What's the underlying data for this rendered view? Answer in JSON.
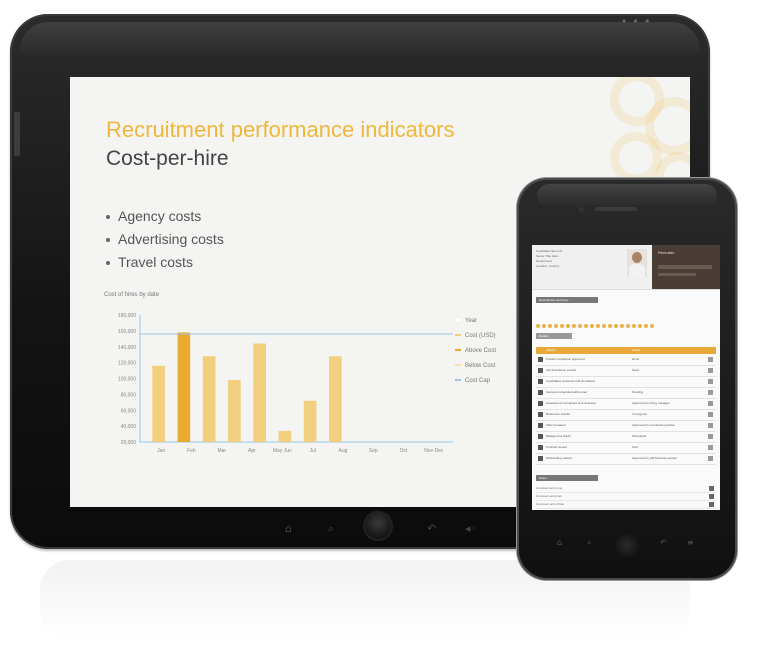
{
  "slide": {
    "title": "Recruitment performance indicators",
    "subtitle": "Cost-per-hire",
    "bullets": [
      "Agency costs",
      "Advertising costs",
      "Travel costs"
    ]
  },
  "chart_title": "Cost of hires by date",
  "chart_data": {
    "type": "bar",
    "title": "Cost of hires by date",
    "categories": [
      "Jan",
      "Feb",
      "Mar",
      "Apr",
      "May",
      "Jun",
      "Jul",
      "Aug",
      "Sep",
      "Oct",
      "Nov",
      "Dec"
    ],
    "tick_labels": [
      "Jan",
      "Feb",
      "Mar",
      "Apr",
      "May Jun",
      "Jul",
      "Aug",
      "Sep",
      "Oct",
      "Nov Dec"
    ],
    "series": [
      {
        "name": "Cost (USD)",
        "values": [
          116000,
          158000,
          128000,
          98000,
          144000,
          34000,
          72000,
          128000,
          0,
          0,
          0,
          0
        ],
        "color": "#f1cf7e",
        "highlight_color": "#e9ab2e"
      }
    ],
    "highlight_index": 1,
    "reference_line": {
      "name": "Cost Cap",
      "value": 156000,
      "color": "#9bc6e6"
    },
    "ylim": [
      20000,
      180000
    ],
    "y_ticks": [
      "180,000",
      "160,000",
      "140,000",
      "120,000",
      "100,000",
      "80,000",
      "60,000",
      "40,000",
      "20,000"
    ],
    "y_values": [
      180000,
      160000,
      140000,
      120000,
      100000,
      80000,
      60000,
      40000,
      20000
    ],
    "grid": false,
    "legend_position": "right",
    "legend": [
      "Year",
      "Cost (USD)",
      "Above Cost",
      "Below Cost",
      "Cost Cap"
    ],
    "legend_colors": [
      "#ffffff",
      "#f1cf7e",
      "#e9ab2e",
      "#f6dfa6",
      "#9bc6e6"
    ]
  },
  "tablet_nav": {
    "home": "⌂",
    "search": "⌕",
    "back": "↶",
    "volume": "◂◦"
  },
  "phone": {
    "contact_lines": [
      "Candidate Name ID",
      "Senior Title Here",
      "Department",
      "Location, Country"
    ],
    "brand_label": "Recruiter",
    "section_1": "Recruitment summary",
    "section_2": "Details",
    "section_3": "Notes",
    "table_header": [
      "Activity",
      "Status"
    ],
    "rows": [
      {
        "t": "Position requisition approved",
        "v": "Done"
      },
      {
        "t": "Job description posted",
        "v": "Open"
      },
      {
        "t": "Candidates screened and shortlisted",
        "v": ""
      },
      {
        "t": "Interview scheduled with panel",
        "v": "Pending"
      },
      {
        "t": "Assessment completed and reviewed",
        "v": "Approved by hiring manager"
      },
      {
        "t": "Reference checks",
        "v": "In progress"
      },
      {
        "t": "Offer prepared",
        "v": "Approved by recruitment partner"
      },
      {
        "t": "Background check",
        "v": "Scheduled"
      },
      {
        "t": "Contract issued",
        "v": "Sent"
      },
      {
        "t": "Onboarding started",
        "v": "Approved by HR business partner"
      }
    ],
    "foot_rows": [
      "Comment entry one",
      "Comment entry two",
      "Comment entry three"
    ],
    "nav": {
      "home": "⌂",
      "search": "⌕",
      "back": "↶",
      "menu": "≡"
    }
  }
}
